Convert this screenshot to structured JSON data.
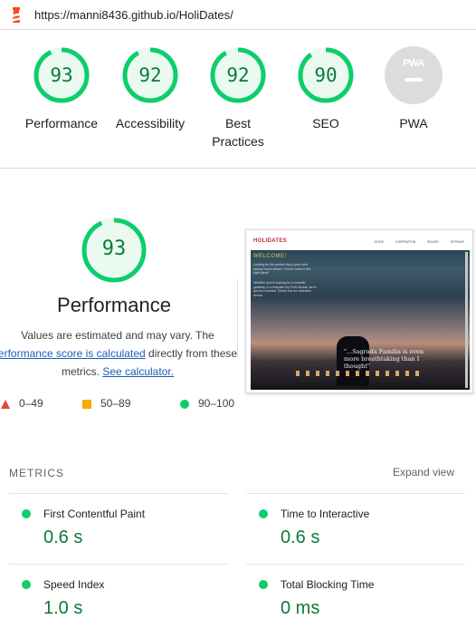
{
  "browser": {
    "url": "https://manni8436.github.io/HoliDates/"
  },
  "categories": [
    {
      "score": "93",
      "label": "Performance",
      "score_fraction": 0.93
    },
    {
      "score": "92",
      "label": "Accessibility",
      "score_fraction": 0.92
    },
    {
      "score": "92",
      "label": "Best Practices",
      "score_fraction": 0.92
    },
    {
      "score": "90",
      "label": "SEO",
      "score_fraction": 0.9
    },
    {
      "score": "",
      "label": "PWA",
      "badge_text": "PWA"
    }
  ],
  "performance": {
    "score": "93",
    "score_fraction": 0.93,
    "title": "Performance",
    "desc_line1": "Values are estimated and may vary. The",
    "desc_link": "erformance score is calculated",
    "desc_after_link": "directly from these",
    "desc_line3_prefix": "metrics.",
    "desc_calc_link": "See calculator."
  },
  "legend": [
    {
      "range": "0–49",
      "shape": "triangle",
      "color": "#e8453c"
    },
    {
      "range": "50–89",
      "shape": "square",
      "color": "#f9ab00"
    },
    {
      "range": "90–100",
      "shape": "circle",
      "color": "#0cce6b"
    }
  ],
  "screenshot": {
    "logo": "HOLIDATES",
    "nav": "HOME INSPIRATION BOARD SITEMAP",
    "welcome": "WELCOME!",
    "intro": "Looking for the perfect trip to your next special travel where? You've come to the right place!",
    "intro2": "Whether you're looking for a romantic getaway or a bespoke trip Find friends, we're got you covered. Check out our collection below!",
    "quote": "\"...Sagrada Familia is even more breathtaking than I thought\""
  },
  "metrics": {
    "title": "METRICS",
    "expand": "Expand view",
    "items": [
      {
        "label": "First Contentful Paint",
        "value": "0.6 s"
      },
      {
        "label": "Time to Interactive",
        "value": "0.6 s"
      },
      {
        "label": "Speed Index",
        "value": "1.0 s"
      },
      {
        "label": "Total Blocking Time",
        "value": "0 ms"
      }
    ]
  },
  "colors": {
    "pass": "#0cce6b",
    "pass_text": "#0c7a3a",
    "average": "#f9ab00",
    "fail": "#e8453c",
    "link": "#1a5fb4"
  }
}
